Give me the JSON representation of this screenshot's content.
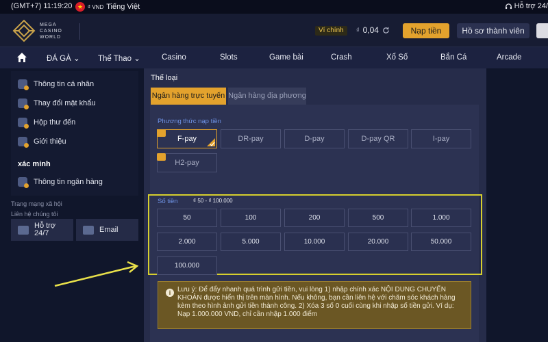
{
  "topbar": {
    "time": "(GMT+7) 11:19:20",
    "currency": "₫ VND",
    "language": "Tiếng Việt",
    "support": "Hỗ trợ 24/"
  },
  "brand": {
    "line1": "MEGA",
    "line2": "CASINO",
    "line3": "WORLD"
  },
  "header": {
    "wallet_label": "Ví chính",
    "currency_symbol": "₫",
    "balance": "0,04",
    "deposit_label": "Nạp tiền",
    "profile_label": "Hồ sơ thành viên"
  },
  "nav": [
    "ĐÁ GÀ",
    "Thể Thao",
    "Casino",
    "Slots",
    "Game bài",
    "Crash",
    "Xổ Số",
    "Bắn Cá",
    "Arcade"
  ],
  "sidebar": {
    "items": [
      "Thông tin cá nhân",
      "Thay đổi mật khẩu",
      "Hộp thư đến",
      "Giới thiệu"
    ],
    "verify_heading": "xác minh",
    "bank_info": "Thông tin ngân hàng",
    "social_label": "Trang mạng xã hội",
    "contact_label": "Liên hệ chúng tôi",
    "support_line1": "Hỗ trợ",
    "support_line2": "24/7",
    "email": "Email"
  },
  "deposit": {
    "section_title": "Thể loại",
    "tabs": [
      "Ngân hàng trực tuyến",
      "Ngân hàng địa phương"
    ],
    "method_label": "Phương thức nạp tiền",
    "methods": [
      "F-pay",
      "DR-pay",
      "D-pay",
      "D-pay QR",
      "I-pay",
      "H2-pay"
    ],
    "selected_method": "F-pay",
    "amount_label": "Số tiền",
    "amount_range": "₫ 50 - ₫ 100.000",
    "amounts": [
      "50",
      "100",
      "200",
      "500",
      "1.000",
      "2.000",
      "5.000",
      "10.000",
      "20.000",
      "50.000",
      "100.000"
    ],
    "notice": "Lưu ý: Để đẩy nhanh quá trình gửi tiền, vui lòng 1) nhập chính xác NỘI DUNG CHUYỂN KHOẢN được hiển thị trên màn hình. Nếu không, bạn cần liên hệ với chăm sóc khách hàng kèm theo hình ảnh gửi tiền thành công. 2) Xóa 3 số 0 cuối cùng khi nhập số tiền gửi. Ví dụ: Nạp 1.000.000 VND, chỉ cần nhập 1.000 điểm"
  },
  "colors": {
    "accent": "#e3a22d",
    "highlight": "#d6cf2e",
    "link_blue": "#6f93e6"
  }
}
